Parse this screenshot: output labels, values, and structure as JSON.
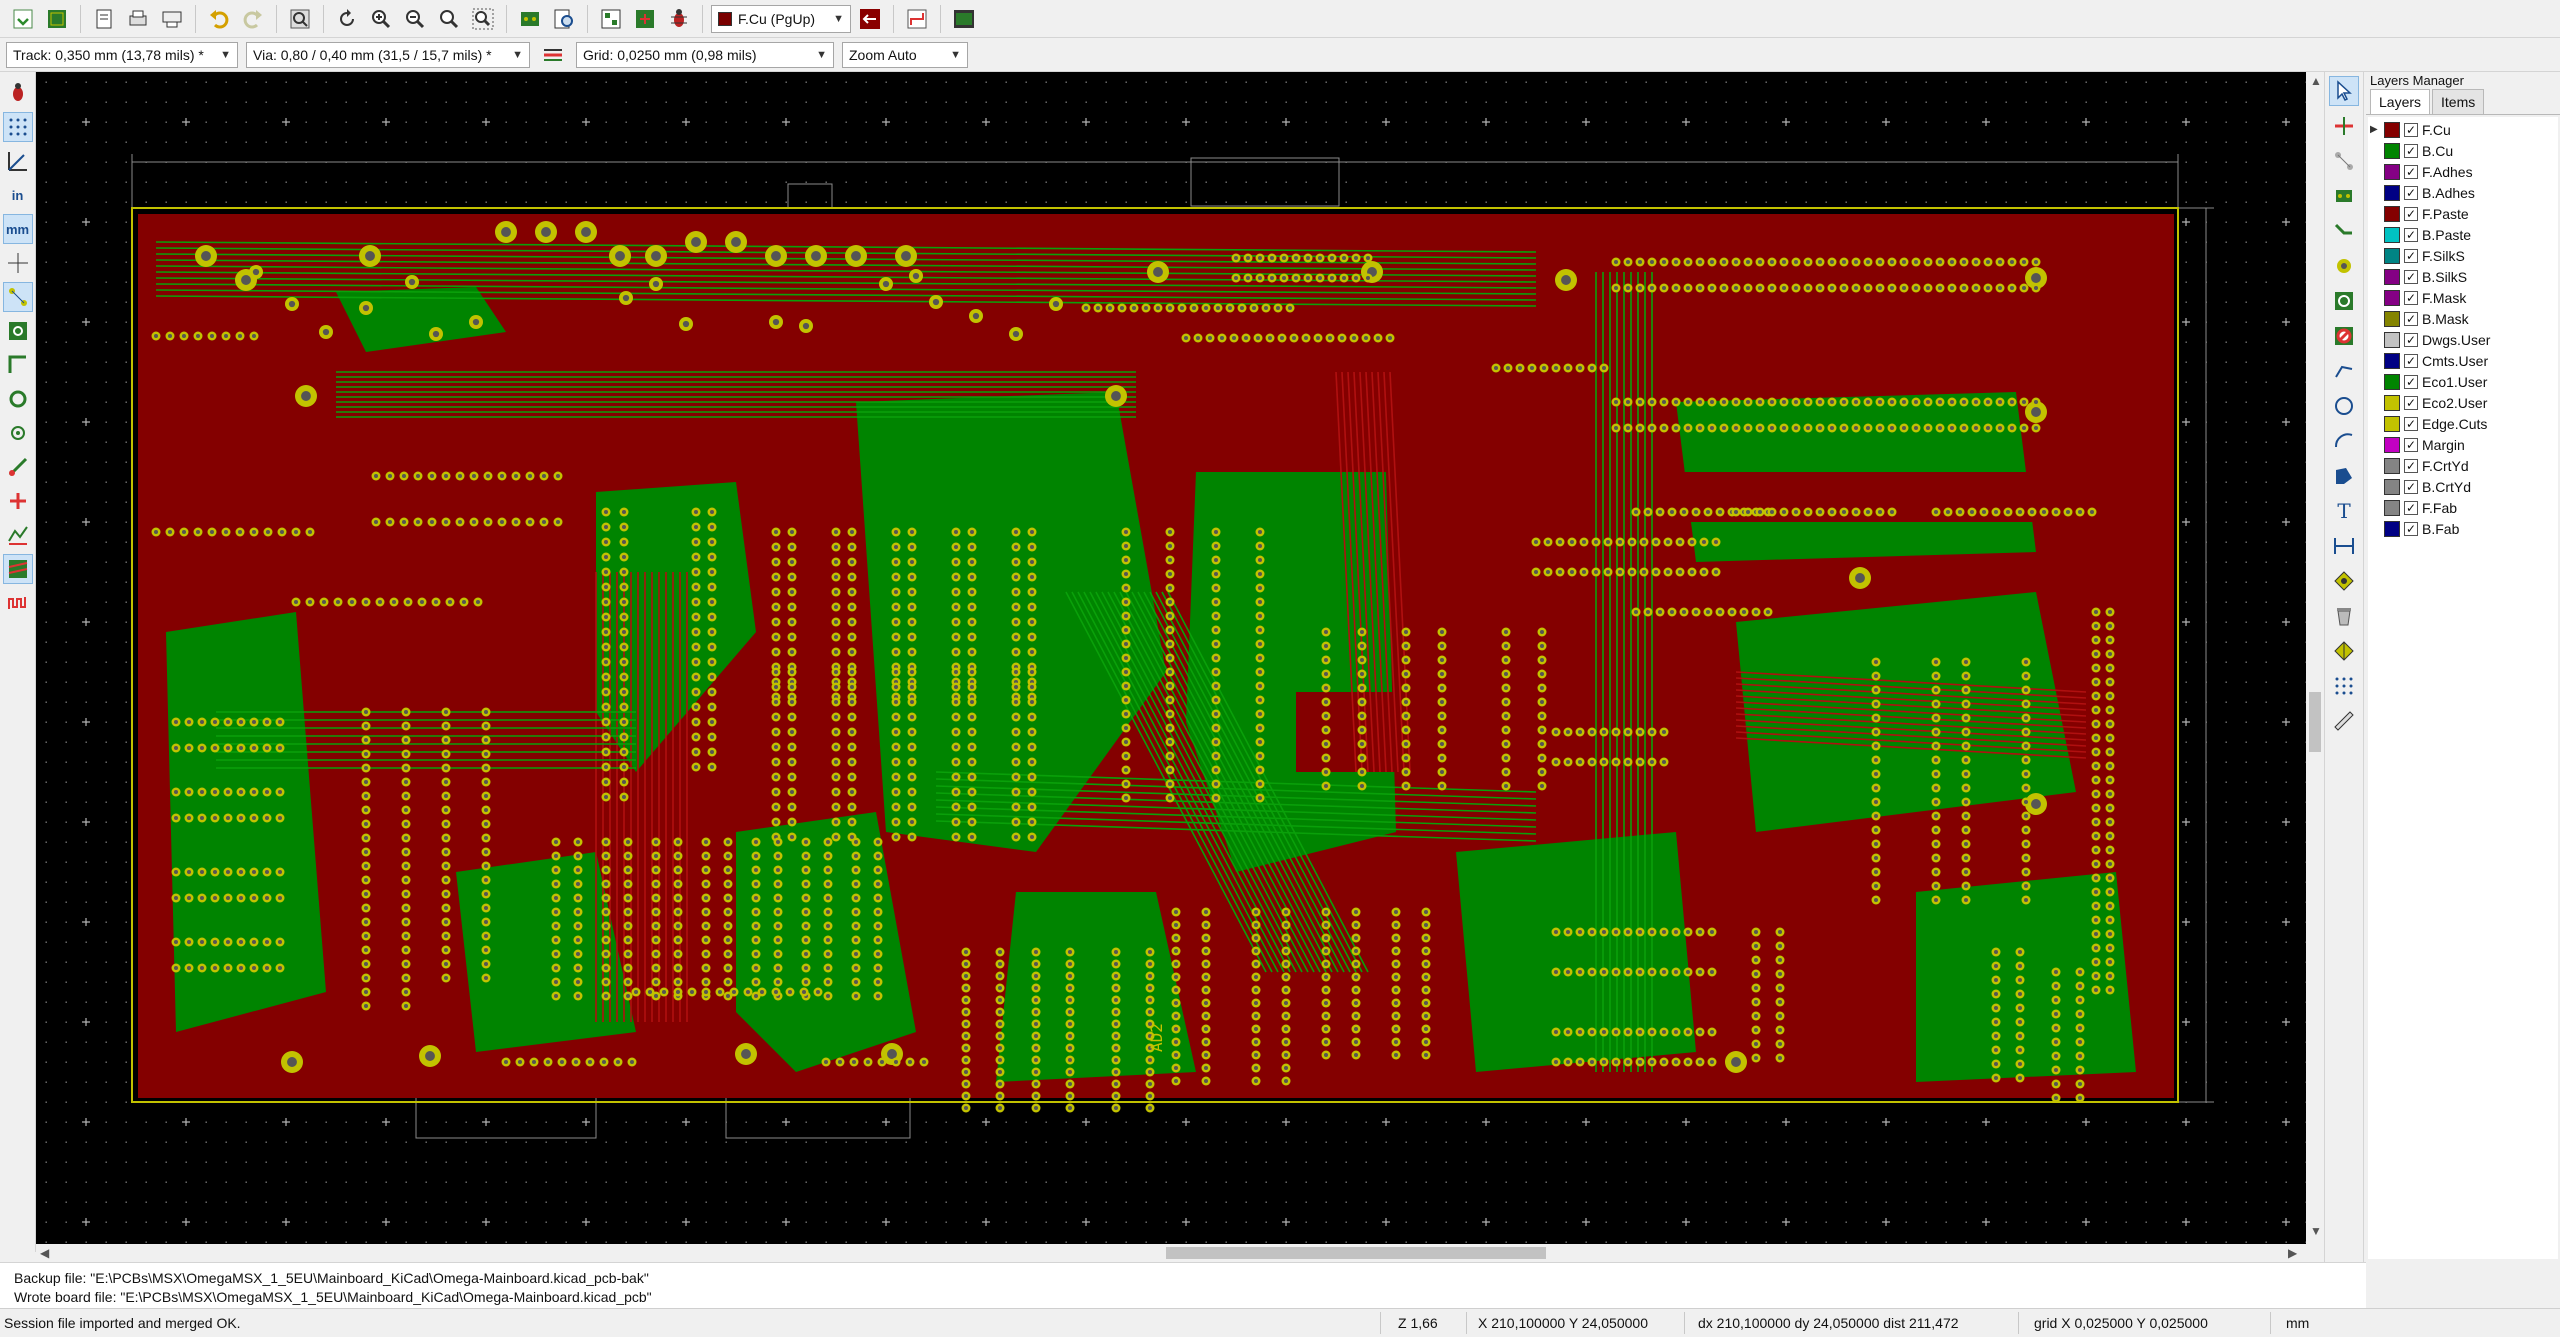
{
  "toolbar": {
    "layer_selector": {
      "label": "F.Cu (PgUp)",
      "color": "#7a0000"
    }
  },
  "options": {
    "track": "Track: 0,350 mm (13,78 mils) *",
    "via": "Via: 0,80 / 0,40 mm (31,5 / 15,7 mils) *",
    "grid": "Grid: 0,0250 mm (0,98 mils)",
    "zoom": "Zoom Auto"
  },
  "left_toolbar": {
    "units_in": "in",
    "units_mm": "mm"
  },
  "board": {
    "silk_label": "AD2"
  },
  "layers_manager": {
    "title": "Layers Manager",
    "tabs": [
      "Layers",
      "Items"
    ],
    "active_tab": "Layers",
    "layers": [
      {
        "name": "F.Cu",
        "color": "#840000",
        "checked": true,
        "active": true
      },
      {
        "name": "B.Cu",
        "color": "#008400",
        "checked": true
      },
      {
        "name": "F.Adhes",
        "color": "#840084",
        "checked": true
      },
      {
        "name": "B.Adhes",
        "color": "#000084",
        "checked": true
      },
      {
        "name": "F.Paste",
        "color": "#840000",
        "checked": true
      },
      {
        "name": "B.Paste",
        "color": "#00c2c2",
        "checked": true
      },
      {
        "name": "F.SilkS",
        "color": "#008484",
        "checked": true
      },
      {
        "name": "B.SilkS",
        "color": "#840084",
        "checked": true
      },
      {
        "name": "F.Mask",
        "color": "#840084",
        "checked": true
      },
      {
        "name": "B.Mask",
        "color": "#848400",
        "checked": true
      },
      {
        "name": "Dwgs.User",
        "color": "#c2c2c2",
        "checked": true
      },
      {
        "name": "Cmts.User",
        "color": "#000084",
        "checked": true
      },
      {
        "name": "Eco1.User",
        "color": "#008400",
        "checked": true
      },
      {
        "name": "Eco2.User",
        "color": "#c2c200",
        "checked": true
      },
      {
        "name": "Edge.Cuts",
        "color": "#c2c200",
        "checked": true
      },
      {
        "name": "Margin",
        "color": "#c200c2",
        "checked": true
      },
      {
        "name": "F.CrtYd",
        "color": "#848484",
        "checked": true
      },
      {
        "name": "B.CrtYd",
        "color": "#848484",
        "checked": true
      },
      {
        "name": "F.Fab",
        "color": "#848484",
        "checked": true
      },
      {
        "name": "B.Fab",
        "color": "#000084",
        "checked": true
      }
    ]
  },
  "messages": {
    "line1": "Backup file: \"E:\\PCBs\\MSX\\OmegaMSX_1_5EU\\Mainboard_KiCad\\Omega-Mainboard.kicad_pcb-bak\"",
    "line2": "Wrote board file: \"E:\\PCBs\\MSX\\OmegaMSX_1_5EU\\Mainboard_KiCad\\Omega-Mainboard.kicad_pcb\""
  },
  "status": {
    "message": "Session file imported and merged OK.",
    "zoom": "Z 1,66",
    "xy": "X 210,100000  Y 24,050000",
    "delta": "dx 210,100000  dy 24,050000  dist 211,472",
    "grid": "grid X 0,025000  Y 0,025000",
    "units": "mm"
  },
  "colors": {
    "canvas_bg": "#000000",
    "front_copper": "#840000",
    "back_copper": "#008400",
    "pad": "#c2c200",
    "edge": "#c2c200",
    "ui_bg": "#f0f0f0"
  }
}
